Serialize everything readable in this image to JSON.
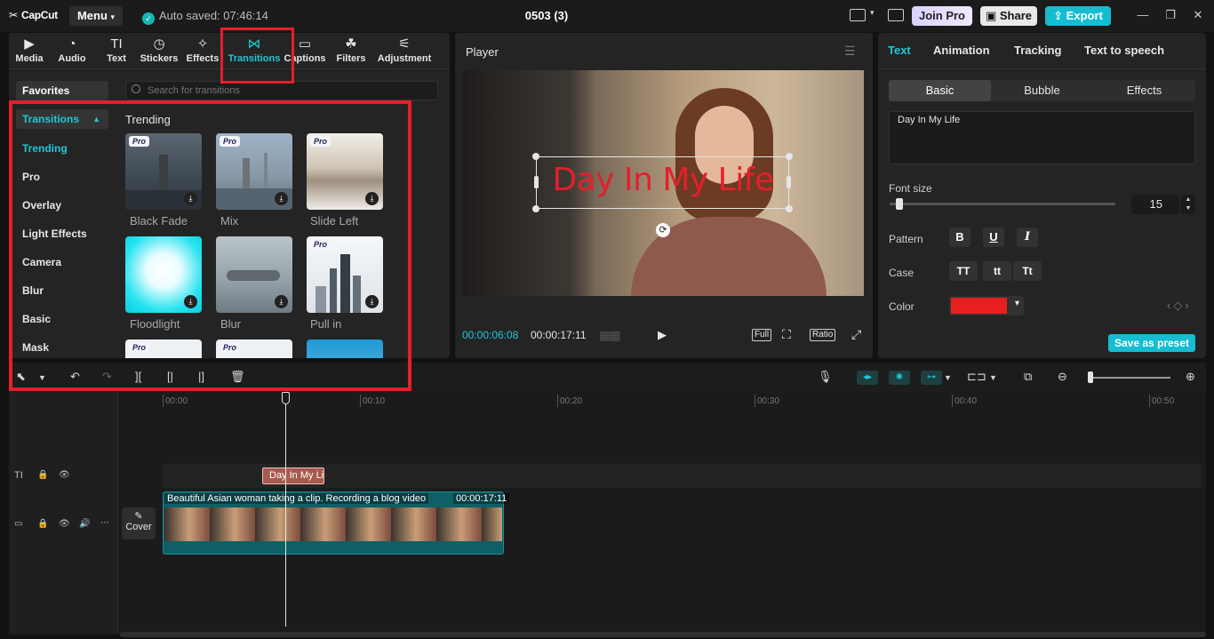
{
  "app": {
    "logo": "CapCut",
    "menu_label": "Menu",
    "autosave": "Auto saved: 07:46:14",
    "project_title": "0503 (3)",
    "join_pro": "Join Pro",
    "share": "Share",
    "export": "Export"
  },
  "toolbar": {
    "tabs": [
      {
        "label": "Media",
        "icon": "media-icon"
      },
      {
        "label": "Audio",
        "icon": "audio-icon"
      },
      {
        "label": "Text",
        "icon": "text-icon"
      },
      {
        "label": "Stickers",
        "icon": "stickers-icon"
      },
      {
        "label": "Effects",
        "icon": "effects-icon"
      },
      {
        "label": "Transitions",
        "icon": "transitions-icon",
        "active": true
      },
      {
        "label": "Captions",
        "icon": "captions-icon"
      },
      {
        "label": "Filters",
        "icon": "filters-icon"
      },
      {
        "label": "Adjustment",
        "icon": "adjustment-icon"
      }
    ]
  },
  "library": {
    "favorites": "Favorites",
    "search_placeholder": "Search for transitions",
    "category_header": "Transitions",
    "categories": [
      "Trending",
      "Pro",
      "Overlay",
      "Light Effects",
      "Camera",
      "Blur",
      "Basic",
      "Mask"
    ],
    "selected_category": "Trending",
    "section_title": "Trending",
    "pro_badge": "Pro",
    "items": [
      {
        "label": "Black Fade",
        "pro": true
      },
      {
        "label": "Mix",
        "pro": true
      },
      {
        "label": "Slide Left",
        "pro": true
      },
      {
        "label": "Floodlight",
        "pro": false
      },
      {
        "label": "Blur",
        "pro": false
      },
      {
        "label": "Pull in",
        "pro": true
      }
    ]
  },
  "player": {
    "title": "Player",
    "overlay_text": "Day In My Life",
    "current_time": "00:00:06:08",
    "total_time": "00:00:17:11",
    "full_label": "Full",
    "ratio_label": "Ratio"
  },
  "inspector": {
    "tabs": [
      "Text",
      "Animation",
      "Tracking",
      "Text to speech"
    ],
    "active_tab": "Text",
    "subtabs": [
      "Basic",
      "Bubble",
      "Effects"
    ],
    "active_subtab": "Basic",
    "text_value": "Day In My Life",
    "font_size_label": "Font size",
    "font_size_value": "15",
    "pattern_label": "Pattern",
    "pattern_buttons": [
      "B",
      "U",
      "I"
    ],
    "case_label": "Case",
    "case_buttons": [
      "TT",
      "tt",
      "Tt"
    ],
    "color_label": "Color",
    "color_value": "#e81f1f",
    "save_preset": "Save as preset"
  },
  "timeline": {
    "ticks": [
      "00:00",
      "00:10",
      "00:20",
      "00:30",
      "00:40",
      "00:50"
    ],
    "text_clip": "Day In My Life",
    "video_clip_name": "Beautiful Asian woman taking a clip. Recording a blog video",
    "video_clip_duration": "00:00:17:11",
    "cover_label": "Cover"
  }
}
